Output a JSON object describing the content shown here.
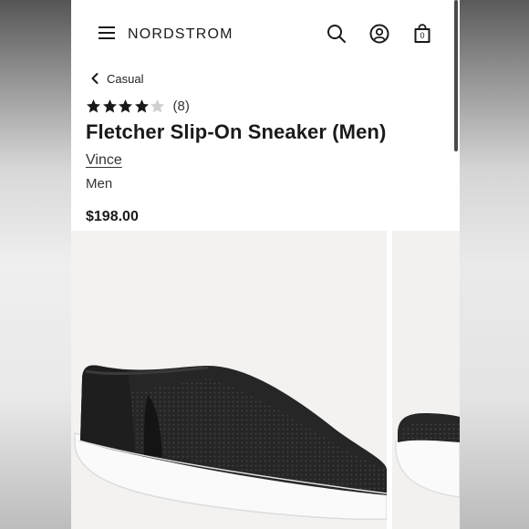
{
  "header": {
    "brand": "NORDSTROM",
    "icons": [
      "menu-icon",
      "search-icon",
      "account-icon",
      "shopping-bag-icon"
    ],
    "bag_count": "0"
  },
  "breadcrumb": {
    "label": "Casual"
  },
  "product": {
    "rating": 4,
    "rating_max": 5,
    "review_count": "(8)",
    "title": "Fletcher Slip-On Sneaker (Men)",
    "brand": "Vince",
    "category": "Men",
    "price": "$198.00"
  },
  "colors": {
    "text": "#1a1a1a",
    "star_filled": "#1a1a1a",
    "star_empty": "#cfcfcf",
    "photo_background": "#f3f2f1"
  }
}
